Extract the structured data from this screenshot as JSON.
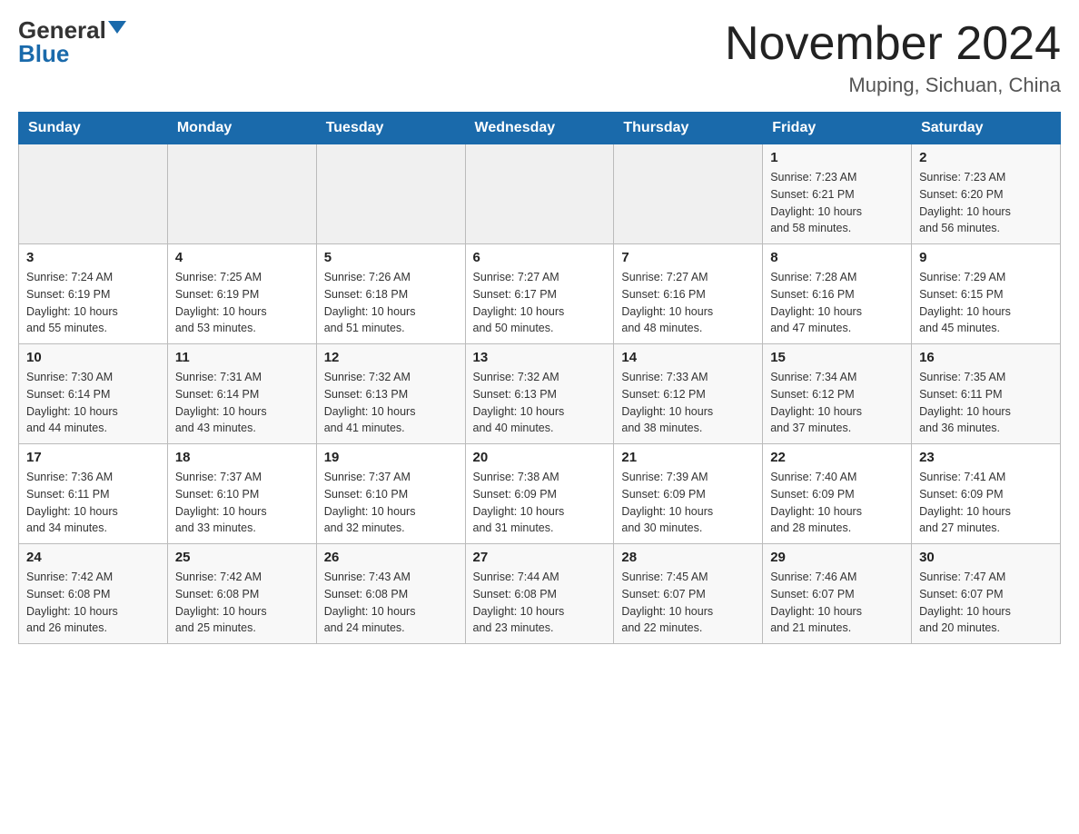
{
  "header": {
    "logo_general": "General",
    "logo_blue": "Blue",
    "title": "November 2024",
    "subtitle": "Muping, Sichuan, China"
  },
  "weekdays": [
    "Sunday",
    "Monday",
    "Tuesday",
    "Wednesday",
    "Thursday",
    "Friday",
    "Saturday"
  ],
  "weeks": [
    [
      {
        "day": "",
        "info": ""
      },
      {
        "day": "",
        "info": ""
      },
      {
        "day": "",
        "info": ""
      },
      {
        "day": "",
        "info": ""
      },
      {
        "day": "",
        "info": ""
      },
      {
        "day": "1",
        "info": "Sunrise: 7:23 AM\nSunset: 6:21 PM\nDaylight: 10 hours\nand 58 minutes."
      },
      {
        "day": "2",
        "info": "Sunrise: 7:23 AM\nSunset: 6:20 PM\nDaylight: 10 hours\nand 56 minutes."
      }
    ],
    [
      {
        "day": "3",
        "info": "Sunrise: 7:24 AM\nSunset: 6:19 PM\nDaylight: 10 hours\nand 55 minutes."
      },
      {
        "day": "4",
        "info": "Sunrise: 7:25 AM\nSunset: 6:19 PM\nDaylight: 10 hours\nand 53 minutes."
      },
      {
        "day": "5",
        "info": "Sunrise: 7:26 AM\nSunset: 6:18 PM\nDaylight: 10 hours\nand 51 minutes."
      },
      {
        "day": "6",
        "info": "Sunrise: 7:27 AM\nSunset: 6:17 PM\nDaylight: 10 hours\nand 50 minutes."
      },
      {
        "day": "7",
        "info": "Sunrise: 7:27 AM\nSunset: 6:16 PM\nDaylight: 10 hours\nand 48 minutes."
      },
      {
        "day": "8",
        "info": "Sunrise: 7:28 AM\nSunset: 6:16 PM\nDaylight: 10 hours\nand 47 minutes."
      },
      {
        "day": "9",
        "info": "Sunrise: 7:29 AM\nSunset: 6:15 PM\nDaylight: 10 hours\nand 45 minutes."
      }
    ],
    [
      {
        "day": "10",
        "info": "Sunrise: 7:30 AM\nSunset: 6:14 PM\nDaylight: 10 hours\nand 44 minutes."
      },
      {
        "day": "11",
        "info": "Sunrise: 7:31 AM\nSunset: 6:14 PM\nDaylight: 10 hours\nand 43 minutes."
      },
      {
        "day": "12",
        "info": "Sunrise: 7:32 AM\nSunset: 6:13 PM\nDaylight: 10 hours\nand 41 minutes."
      },
      {
        "day": "13",
        "info": "Sunrise: 7:32 AM\nSunset: 6:13 PM\nDaylight: 10 hours\nand 40 minutes."
      },
      {
        "day": "14",
        "info": "Sunrise: 7:33 AM\nSunset: 6:12 PM\nDaylight: 10 hours\nand 38 minutes."
      },
      {
        "day": "15",
        "info": "Sunrise: 7:34 AM\nSunset: 6:12 PM\nDaylight: 10 hours\nand 37 minutes."
      },
      {
        "day": "16",
        "info": "Sunrise: 7:35 AM\nSunset: 6:11 PM\nDaylight: 10 hours\nand 36 minutes."
      }
    ],
    [
      {
        "day": "17",
        "info": "Sunrise: 7:36 AM\nSunset: 6:11 PM\nDaylight: 10 hours\nand 34 minutes."
      },
      {
        "day": "18",
        "info": "Sunrise: 7:37 AM\nSunset: 6:10 PM\nDaylight: 10 hours\nand 33 minutes."
      },
      {
        "day": "19",
        "info": "Sunrise: 7:37 AM\nSunset: 6:10 PM\nDaylight: 10 hours\nand 32 minutes."
      },
      {
        "day": "20",
        "info": "Sunrise: 7:38 AM\nSunset: 6:09 PM\nDaylight: 10 hours\nand 31 minutes."
      },
      {
        "day": "21",
        "info": "Sunrise: 7:39 AM\nSunset: 6:09 PM\nDaylight: 10 hours\nand 30 minutes."
      },
      {
        "day": "22",
        "info": "Sunrise: 7:40 AM\nSunset: 6:09 PM\nDaylight: 10 hours\nand 28 minutes."
      },
      {
        "day": "23",
        "info": "Sunrise: 7:41 AM\nSunset: 6:09 PM\nDaylight: 10 hours\nand 27 minutes."
      }
    ],
    [
      {
        "day": "24",
        "info": "Sunrise: 7:42 AM\nSunset: 6:08 PM\nDaylight: 10 hours\nand 26 minutes."
      },
      {
        "day": "25",
        "info": "Sunrise: 7:42 AM\nSunset: 6:08 PM\nDaylight: 10 hours\nand 25 minutes."
      },
      {
        "day": "26",
        "info": "Sunrise: 7:43 AM\nSunset: 6:08 PM\nDaylight: 10 hours\nand 24 minutes."
      },
      {
        "day": "27",
        "info": "Sunrise: 7:44 AM\nSunset: 6:08 PM\nDaylight: 10 hours\nand 23 minutes."
      },
      {
        "day": "28",
        "info": "Sunrise: 7:45 AM\nSunset: 6:07 PM\nDaylight: 10 hours\nand 22 minutes."
      },
      {
        "day": "29",
        "info": "Sunrise: 7:46 AM\nSunset: 6:07 PM\nDaylight: 10 hours\nand 21 minutes."
      },
      {
        "day": "30",
        "info": "Sunrise: 7:47 AM\nSunset: 6:07 PM\nDaylight: 10 hours\nand 20 minutes."
      }
    ]
  ]
}
